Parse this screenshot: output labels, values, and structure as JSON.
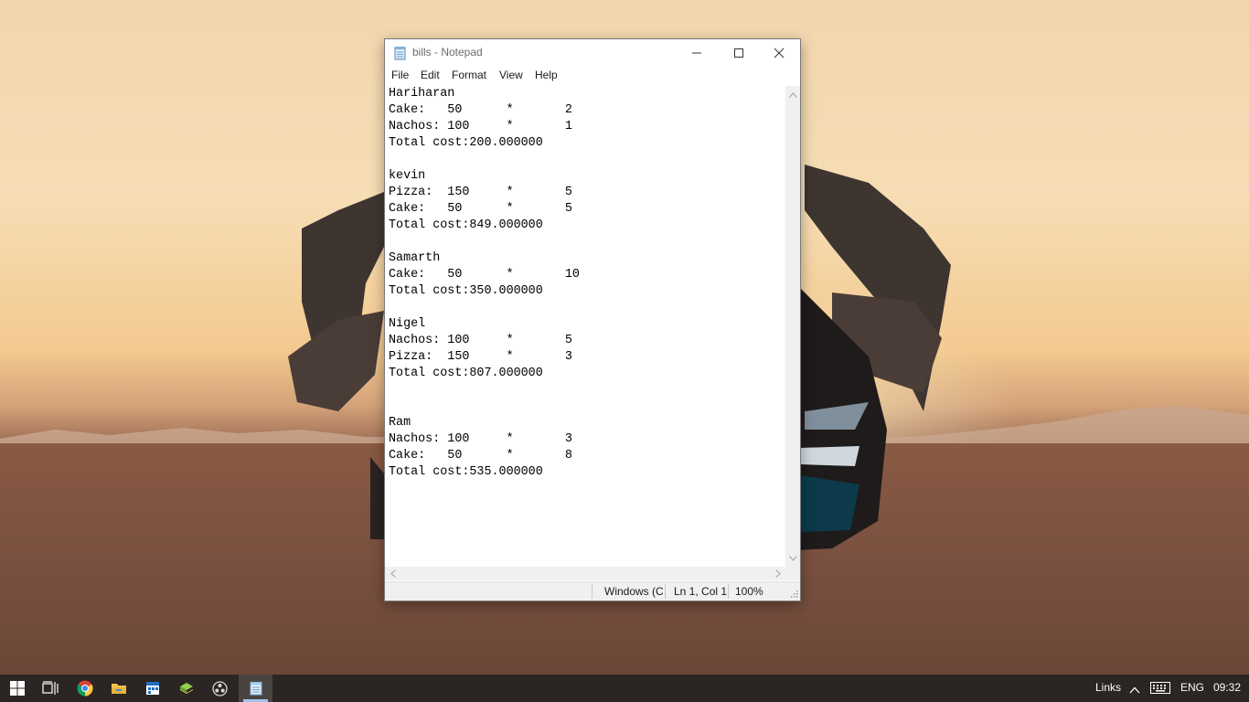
{
  "window": {
    "title": "bills - Notepad",
    "menu": [
      "File",
      "Edit",
      "Format",
      "View",
      "Help"
    ],
    "content_lines": [
      "Hariharan",
      "Cake:   50      *       2",
      "Nachos: 100     *       1",
      "Total cost:200.000000",
      "",
      "kevin",
      "Pizza:  150     *       5",
      "Cake:   50      *       5",
      "Total cost:849.000000",
      "",
      "Samarth",
      "Cake:   50      *       10",
      "Total cost:350.000000",
      "",
      "Nigel",
      "Nachos: 100     *       5",
      "Pizza:  150     *       3",
      "Total cost:807.000000",
      "",
      "",
      "Ram",
      "Nachos: 100     *       3",
      "Cake:   50      *       8",
      "Total cost:535.000000"
    ],
    "status": {
      "encoding": "Windows (C",
      "position": "Ln 1, Col 1",
      "zoom": "100%"
    }
  },
  "taskbar": {
    "pinned": [
      "windows-start-icon",
      "task-view-icon",
      "chrome-icon",
      "file-explorer-icon",
      "calendar-app-icon",
      "bluestacks-icon",
      "obs-icon",
      "notepad-icon"
    ],
    "tray": {
      "links": "Links",
      "language": "ENG",
      "time": "09:32"
    }
  },
  "colors": {
    "taskbar": "#2b2623",
    "window_border": "#7a7a7a",
    "active_indicator": "#9fc6e8"
  }
}
